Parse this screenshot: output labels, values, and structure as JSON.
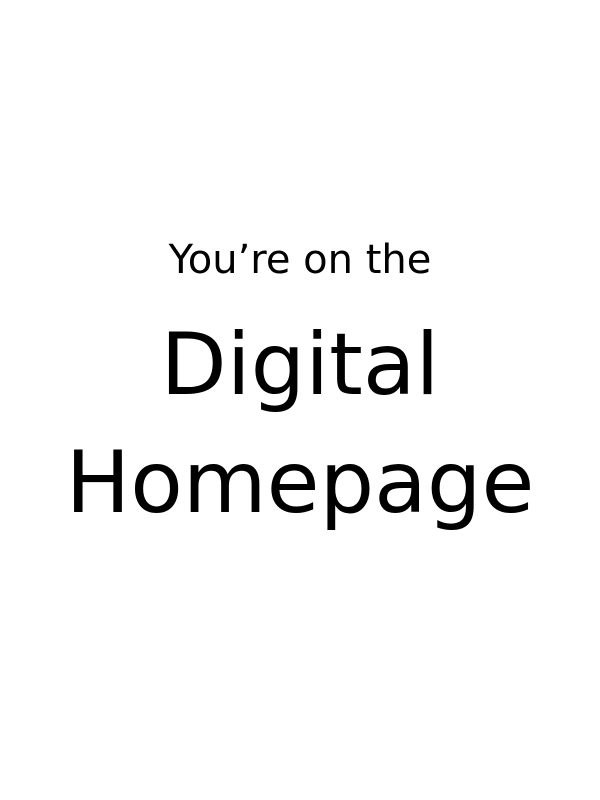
{
  "page": {
    "intro": "You’re on the",
    "title_line1": "Digital",
    "title_line2": "Homepage"
  }
}
